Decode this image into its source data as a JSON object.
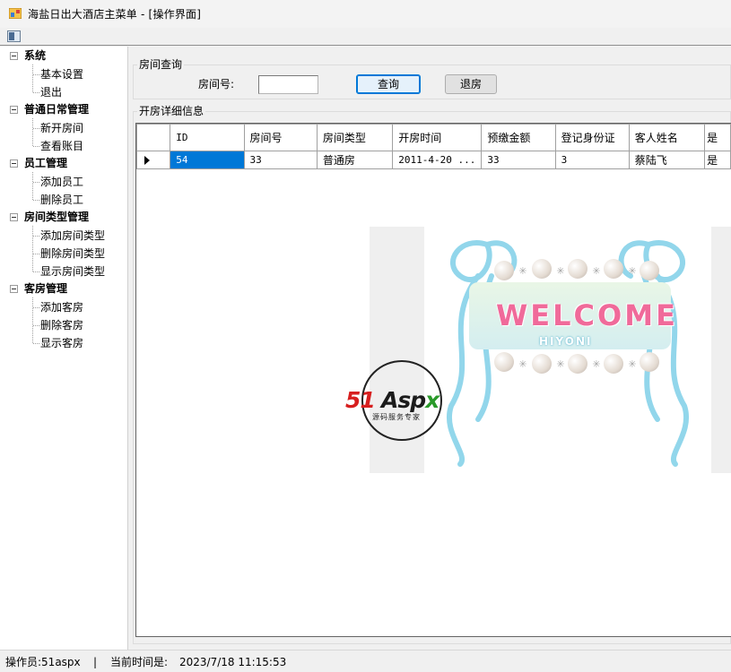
{
  "window": {
    "title": "海盐日出大酒店主菜单 - [操作界面]"
  },
  "menubar": {
    "mdi_icon": "mdi-child-window-icon"
  },
  "tree": {
    "groups": [
      {
        "label": "系统",
        "items": [
          {
            "label": "基本设置"
          },
          {
            "label": "退出"
          }
        ]
      },
      {
        "label": "普通日常管理",
        "items": [
          {
            "label": "新开房间"
          },
          {
            "label": "查看账目"
          }
        ]
      },
      {
        "label": "员工管理",
        "items": [
          {
            "label": "添加员工"
          },
          {
            "label": "删除员工"
          }
        ]
      },
      {
        "label": "房间类型管理",
        "items": [
          {
            "label": "添加房间类型"
          },
          {
            "label": "删除房间类型"
          },
          {
            "label": "显示房间类型"
          }
        ]
      },
      {
        "label": "客房管理",
        "items": [
          {
            "label": "添加客房"
          },
          {
            "label": "删除客房"
          },
          {
            "label": "显示客房"
          }
        ]
      }
    ]
  },
  "query": {
    "group_label": "房间查询",
    "room_no_label": "房间号:",
    "room_no_value": "",
    "query_button": "查询",
    "checkout_button": "退房"
  },
  "details": {
    "group_label": "开房详细信息",
    "columns": [
      "ID",
      "房间号",
      "房间类型",
      "开房时间",
      "预缴金额",
      "登记身份证",
      "客人姓名",
      "是"
    ],
    "rows": [
      [
        "54",
        "33",
        "普通房",
        "2011-4-20 ...",
        "33",
        "3",
        "蔡陆飞",
        "是"
      ]
    ]
  },
  "welcome_image": {
    "main_text": "WELCOME",
    "sub_text": "HIYONI"
  },
  "logo": {
    "number": "51",
    "brand_a": "Asp",
    "brand_b": "x",
    "tagline": "源码服务专家"
  },
  "statusbar": {
    "operator": "操作员:51aspx",
    "separator": "|",
    "time_label": "当前时间是:",
    "time_value": "2023/7/18  11:15:53"
  },
  "colors": {
    "selection": "#0078d7",
    "logo_red": "#d71f1f",
    "logo_green": "#2a9a2a",
    "welcome_pink": "#f06a9a",
    "ribbon_blue": "#7fd0e8"
  }
}
